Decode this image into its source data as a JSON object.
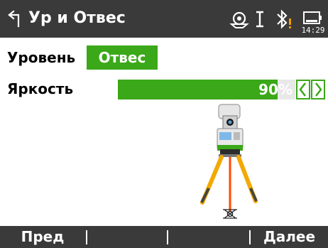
{
  "header": {
    "title": "Ур и Отвес",
    "time": "14:29",
    "icons": [
      "back-icon",
      "laser-plummet-icon",
      "cursor-i-icon",
      "bluetooth-warning-icon",
      "battery-icon"
    ]
  },
  "tabs": [
    {
      "label": "Уровень",
      "active": false
    },
    {
      "label": "Отвес",
      "active": true
    }
  ],
  "brightness": {
    "label": "Яркость",
    "value_text": "90%",
    "value": 0.9
  },
  "softkeys": {
    "prev": "Пред",
    "f2": "",
    "f3": "",
    "next": "Далее"
  },
  "colors": {
    "accent": "#3aa818",
    "bar": "#3a3a3a",
    "tripod_leg": "#f2a900",
    "laser": "#ff4a00"
  }
}
